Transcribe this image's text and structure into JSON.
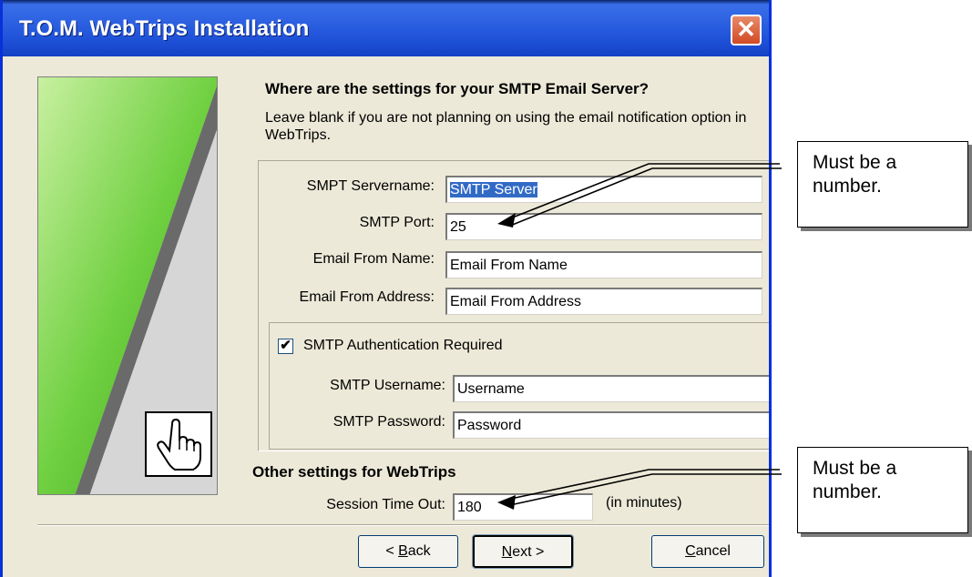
{
  "window": {
    "title": "T.O.M. WebTrips Installation",
    "close_label": "✕"
  },
  "page": {
    "heading": "Where are the settings for your SMTP Email Server?",
    "description": "Leave blank if you are not planning on using the email notification option in WebTrips."
  },
  "smtp": {
    "servername_label": "SMPT Servername:",
    "servername_value": "SMTP Server",
    "port_label": "SMTP Port:",
    "port_value": "25",
    "from_name_label": "Email From Name:",
    "from_name_value": "Email From Name",
    "from_address_label": "Email From Address:",
    "from_address_value": "Email From Address"
  },
  "auth": {
    "checkbox_label": "SMTP Authentication Required",
    "checked": true,
    "checkmark": "✔",
    "username_label": "SMTP Username:",
    "username_value": "Username",
    "password_label": "SMTP Password:",
    "password_value": "Password"
  },
  "other": {
    "heading": "Other settings for WebTrips",
    "timeout_label": "Session Time Out:",
    "timeout_value": "180",
    "timeout_units": "(in minutes)"
  },
  "buttons": {
    "back_prefix": "< ",
    "back_key": "B",
    "back_rest": "ack",
    "next_key": "N",
    "next_rest": "ext >",
    "cancel_key": "C",
    "cancel_rest": "ancel"
  },
  "callouts": [
    {
      "text": "Must be a number."
    },
    {
      "text": "Must be a number."
    }
  ],
  "icons": {
    "hand": "hand-pointer-icon"
  }
}
